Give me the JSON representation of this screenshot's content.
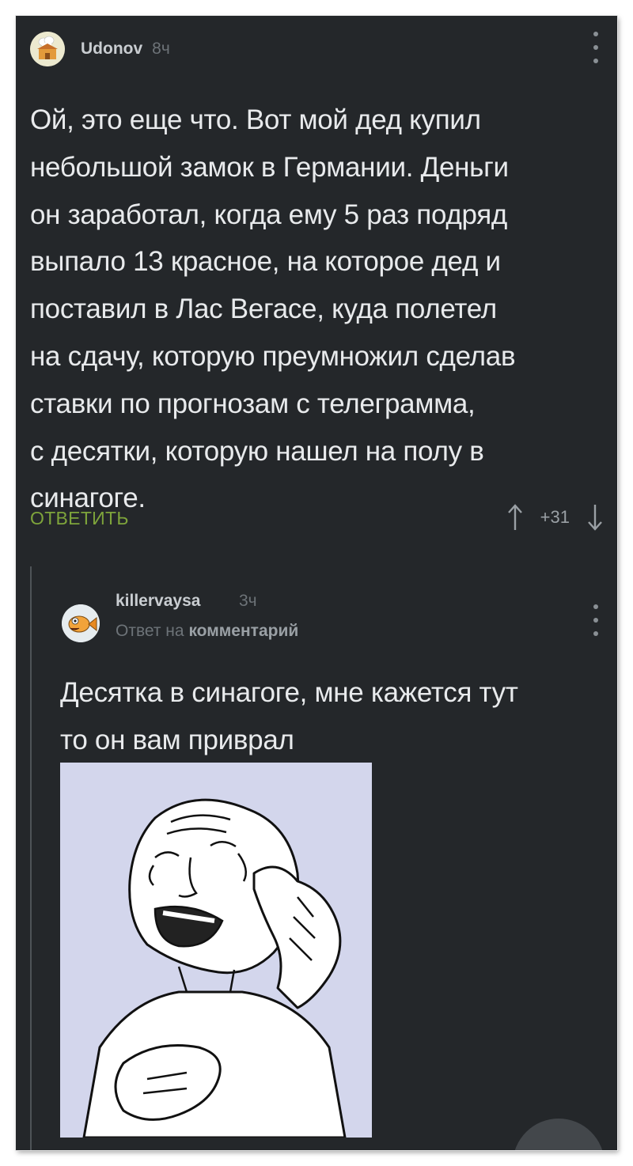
{
  "comment1": {
    "author": "Udonov",
    "time": "8ч",
    "text": "Ой, это еще что. Вот мой дед купил\nнебольшой замок в Германии. Деньги\nон заработал, когда ему 5 раз подряд\nвыпало 13 красное, на которое дед и\nпоставил в Лас Вегасе, куда полетел\nна сдачу, которую преумножил сделав\nставки по прогнозам с телеграмма,\nс десятки, которую нашел на полу в\nсинагоге.",
    "reply_label": "ОТВЕТИТЬ",
    "rating": "+31",
    "avatar_icon": "chef-house-avatar-icon",
    "up_icon": "arrow-up-icon",
    "down_icon": "arrow-down-icon",
    "more_icon": "more-vertical-icon"
  },
  "comment2": {
    "author": "killervaysa",
    "time": "3ч",
    "reply_prefix": "Ответ на",
    "reply_target": "комментарий",
    "text": "Десятка в синагоге, мне кажется тут\nто он вам приврал",
    "avatar_icon": "fish-avatar-icon",
    "image_icon": "crying-laughing-meme-image",
    "more_icon": "more-vertical-icon"
  },
  "colors": {
    "background": "#24272a",
    "text": "#e8eaec",
    "muted": "#6d7378",
    "accent_green": "#7ea43b",
    "meme_bg": "#d3d6ec"
  }
}
